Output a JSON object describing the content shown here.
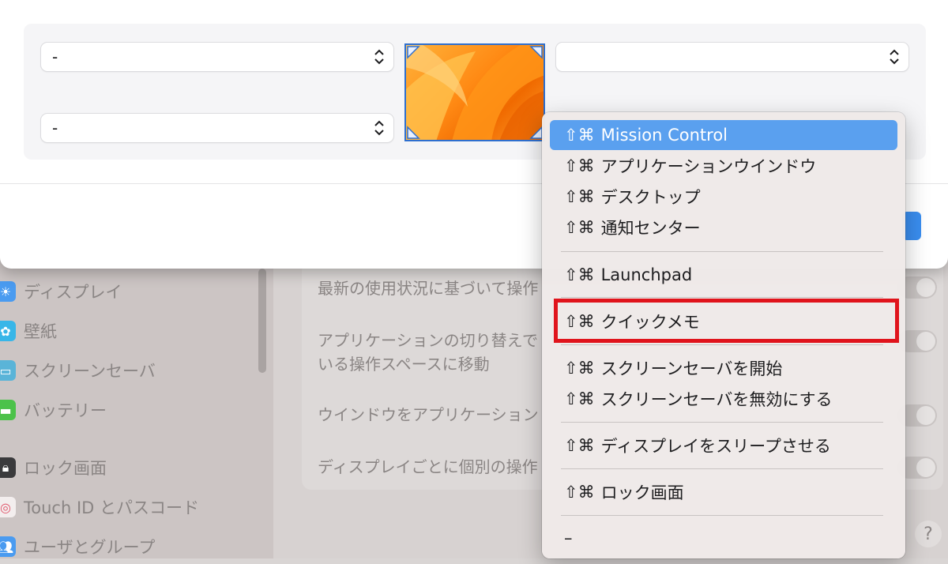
{
  "sheet": {
    "corners": {
      "top_left": "-",
      "bottom_left": "-",
      "top_right": "",
      "bottom_right": ""
    },
    "thumbnail_icon": "wallpaper-ventura"
  },
  "menu": {
    "items": [
      {
        "keys": "⇧⌘",
        "label": "Mission Control",
        "selected": true
      },
      {
        "keys": "⇧⌘",
        "label": "アプリケーションウインドウ"
      },
      {
        "keys": "⇧⌘",
        "label": "デスクトップ"
      },
      {
        "keys": "⇧⌘",
        "label": "通知センター"
      },
      {
        "keys": "⇧⌘",
        "label": "Launchpad"
      },
      {
        "keys": "⇧⌘",
        "label": "クイックメモ",
        "highlighted": true
      },
      {
        "keys": "⇧⌘",
        "label": "スクリーンセーバを開始"
      },
      {
        "keys": "⇧⌘",
        "label": "スクリーンセーバを無効にする"
      },
      {
        "keys": "⇧⌘",
        "label": "ディスプレイをスリープさせる"
      },
      {
        "keys": "⇧⌘",
        "label": "ロック画面"
      },
      {
        "keys": "–",
        "label": ""
      }
    ]
  },
  "sidebar": {
    "items": [
      {
        "label": "ディスプレイ",
        "icon": "display-icon",
        "color": "#4a9bf0"
      },
      {
        "label": "壁紙",
        "icon": "wallpaper-icon",
        "color": "#38b6e8"
      },
      {
        "label": "スクリーンセーバ",
        "icon": "screensaver-icon",
        "color": "#5ab4d8"
      },
      {
        "label": "バッテリー",
        "icon": "battery-icon",
        "color": "#4cc24a"
      },
      {
        "label": "ロック画面",
        "icon": "lock-icon",
        "color": "#3a3a3c"
      },
      {
        "label": "Touch ID とパスコード",
        "icon": "fingerprint-icon",
        "color": "#f0f0f0"
      },
      {
        "label": "ユーザとグループ",
        "icon": "users-icon",
        "color": "#4a9bf0"
      }
    ]
  },
  "main": {
    "rows": [
      {
        "label": "最新の使用状況に基づいて操作"
      },
      {
        "label": "アプリケーションの切り替えで",
        "label2": "いる操作スペースに移動"
      },
      {
        "label": "ウインドウをアプリケーション"
      },
      {
        "label": "ディスプレイごとに個別の操作"
      }
    ],
    "help": "?"
  },
  "colors": {
    "menu_selection": "#5aa0ef",
    "highlight_box": "#e0141c",
    "accent": "#3a8ef0"
  }
}
